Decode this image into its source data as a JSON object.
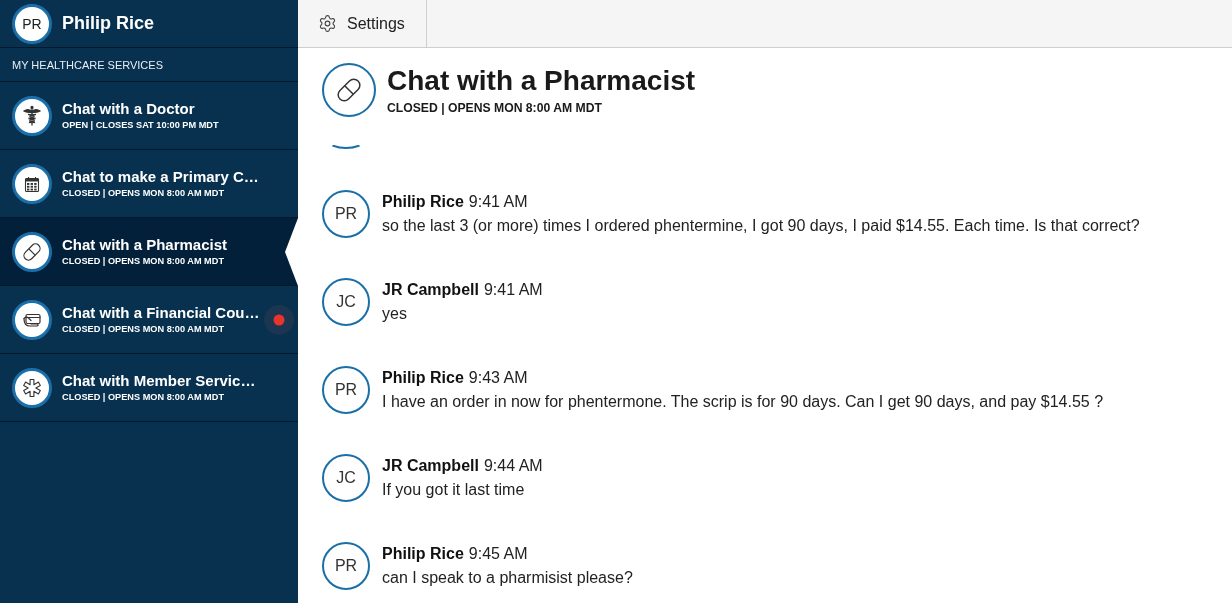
{
  "user": {
    "initials": "PR",
    "name": "Philip Rice"
  },
  "sidebar": {
    "section_title": "MY HEALTHCARE SERVICES",
    "items": [
      {
        "title": "Chat with a Doctor",
        "status": "OPEN | CLOSES SAT 10:00 PM MDT",
        "selected": false,
        "unread": false
      },
      {
        "title": "Chat to make a Primary C…",
        "status": "CLOSED | OPENS MON 8:00 AM MDT",
        "selected": false,
        "unread": false
      },
      {
        "title": "Chat with a Pharmacist",
        "status": "CLOSED | OPENS MON 8:00 AM MDT",
        "selected": true,
        "unread": false
      },
      {
        "title": "Chat with a Financial Cou…",
        "status": "CLOSED | OPENS MON 8:00 AM MDT",
        "selected": false,
        "unread": true
      },
      {
        "title": "Chat with Member Servic…",
        "status": "CLOSED | OPENS MON 8:00 AM MDT",
        "selected": false,
        "unread": false
      }
    ]
  },
  "toolbar": {
    "settings_label": "Settings"
  },
  "chat": {
    "title": "Chat with a Pharmacist",
    "status": "CLOSED | OPENS MON 8:00 AM MDT",
    "messages": [
      {
        "initials": "PR",
        "author": "Philip Rice",
        "time": "9:41 AM",
        "text": "so the last 3 (or more) times I ordered phentermine, I got 90 days, I paid $14.55. Each time. Is that correct?"
      },
      {
        "initials": "JC",
        "author": "JR Campbell",
        "time": "9:41 AM",
        "text": "yes"
      },
      {
        "initials": "PR",
        "author": "Philip Rice",
        "time": "9:43 AM",
        "text": "I have an order in now for phentermone. The scrip is for 90 days. Can I get 90 days, and pay $14.55 ?"
      },
      {
        "initials": "JC",
        "author": "JR Campbell",
        "time": "9:44 AM",
        "text": "If you got it last time"
      },
      {
        "initials": "PR",
        "author": "Philip Rice",
        "time": "9:45 AM",
        "text": "can I speak to a pharmisist please?"
      }
    ]
  }
}
